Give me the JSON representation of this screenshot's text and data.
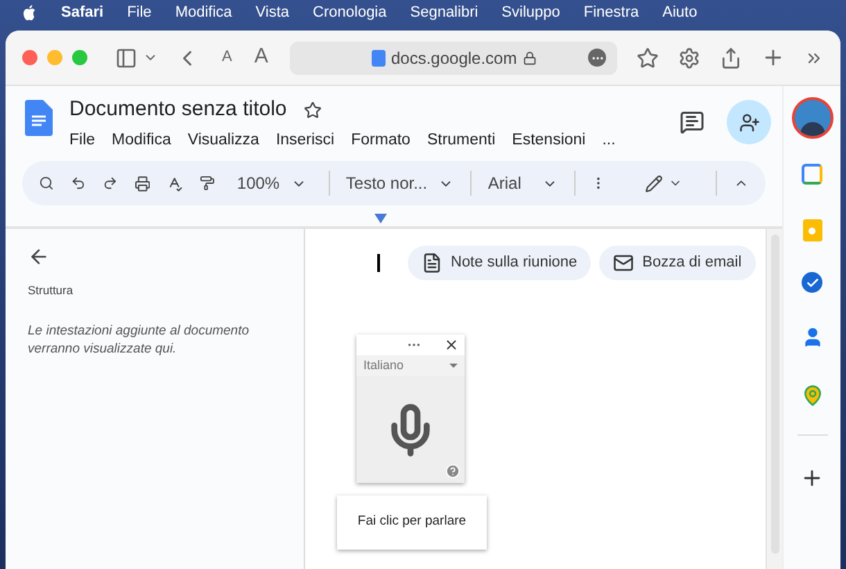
{
  "menubar": {
    "app": "Safari",
    "items": [
      "File",
      "Modifica",
      "Vista",
      "Cronologia",
      "Segnalibri",
      "Sviluppo",
      "Finestra",
      "Aiuto"
    ]
  },
  "browser": {
    "text_smaller": "A",
    "text_larger": "A",
    "url": "docs.google.com"
  },
  "document": {
    "title": "Documento senza titolo",
    "menus": [
      "File",
      "Modifica",
      "Visualizza",
      "Inserisci",
      "Formato",
      "Strumenti",
      "Estensioni",
      "..."
    ]
  },
  "toolbar": {
    "zoom": "100%",
    "style": "Testo nor...",
    "font": "Arial"
  },
  "outline": {
    "title": "Struttura",
    "empty_text": "Le intestazioni aggiunte al documento verranno visualizzate qui."
  },
  "chips": [
    {
      "kind": "notes",
      "label": "Note sulla riunione"
    },
    {
      "kind": "email",
      "label": "Bozza di email"
    }
  ],
  "voice_typing": {
    "language": "Italiano",
    "tooltip": "Fai clic per parlare"
  }
}
